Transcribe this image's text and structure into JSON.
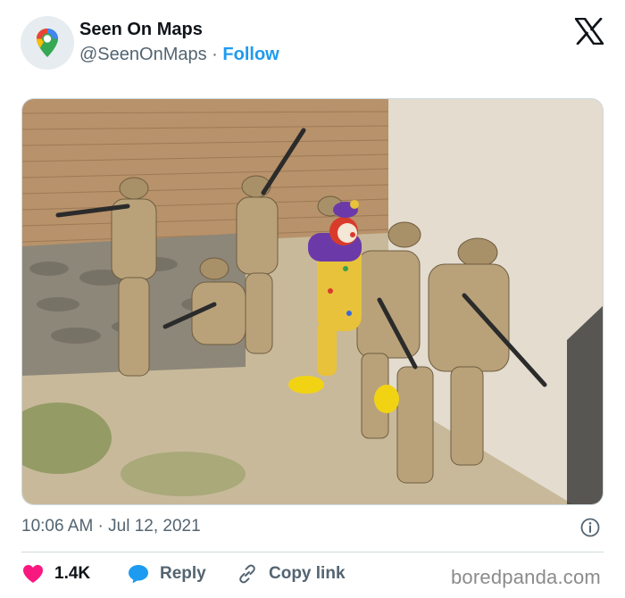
{
  "tweet": {
    "author": {
      "display_name": "Seen On Maps",
      "handle": "@SeenOnMaps",
      "separator": "·",
      "follow_label": "Follow",
      "avatar_icon": "map-pin-icon"
    },
    "platform_icon": "x-logo-icon",
    "image": {
      "kind": "photo",
      "subject_icon": "photo-icon"
    },
    "timestamp": "10:06 AM · Jul 12, 2021",
    "actions": {
      "likes": "1.4K",
      "reply_label": "Reply",
      "copy_link_label": "Copy link"
    },
    "colors": {
      "accent": "#1d9bf0",
      "heart": "#f91880",
      "secondary_text": "#536471"
    }
  },
  "watermark": "boredpanda.com"
}
